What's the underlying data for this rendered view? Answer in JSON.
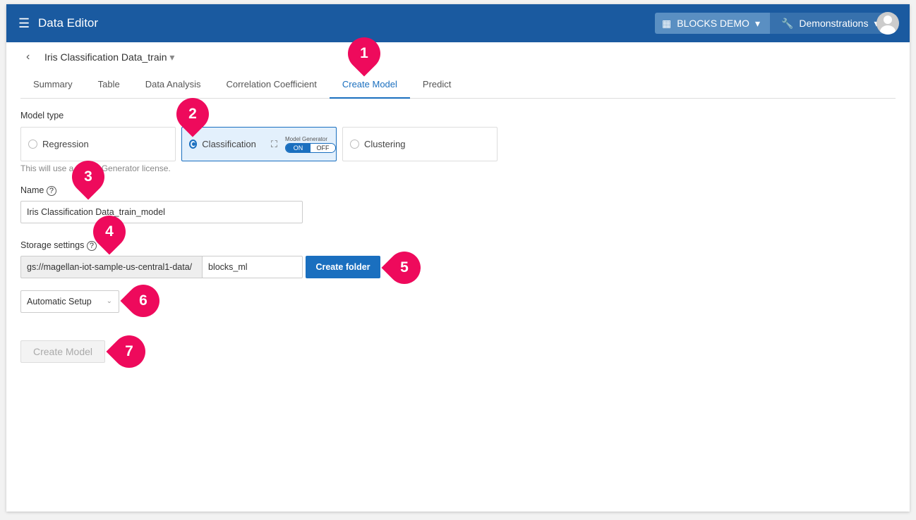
{
  "header": {
    "title": "Data Editor",
    "org": "BLOCKS DEMO",
    "project": "Demonstrations"
  },
  "dataset": {
    "name": "Iris Classification Data_train"
  },
  "tabs": [
    "Summary",
    "Table",
    "Data Analysis",
    "Correlation Coefficient",
    "Create Model",
    "Predict"
  ],
  "active_tab": "Create Model",
  "form": {
    "model_type_label": "Model type",
    "types": [
      "Regression",
      "Classification",
      "Clustering"
    ],
    "selected_type": "Classification",
    "model_generator_label": "Model Generator",
    "toggle_on": "ON",
    "toggle_off": "OFF",
    "license_note": "This will use a Model Generator license.",
    "name_label": "Name",
    "name_value": "Iris Classification Data_train_model",
    "storage_label": "Storage settings",
    "storage_prefix": "gs://magellan-iot-sample-us-central1-data/",
    "storage_folder": "blocks_ml",
    "create_folder": "Create folder",
    "setup_select": "Automatic Setup",
    "create_model": "Create Model"
  },
  "markers": [
    "1",
    "2",
    "3",
    "4",
    "5",
    "6",
    "7"
  ],
  "colors": {
    "header": "#1a5aa0",
    "accent": "#1a6fbf",
    "marker": "#ee0a5c"
  }
}
